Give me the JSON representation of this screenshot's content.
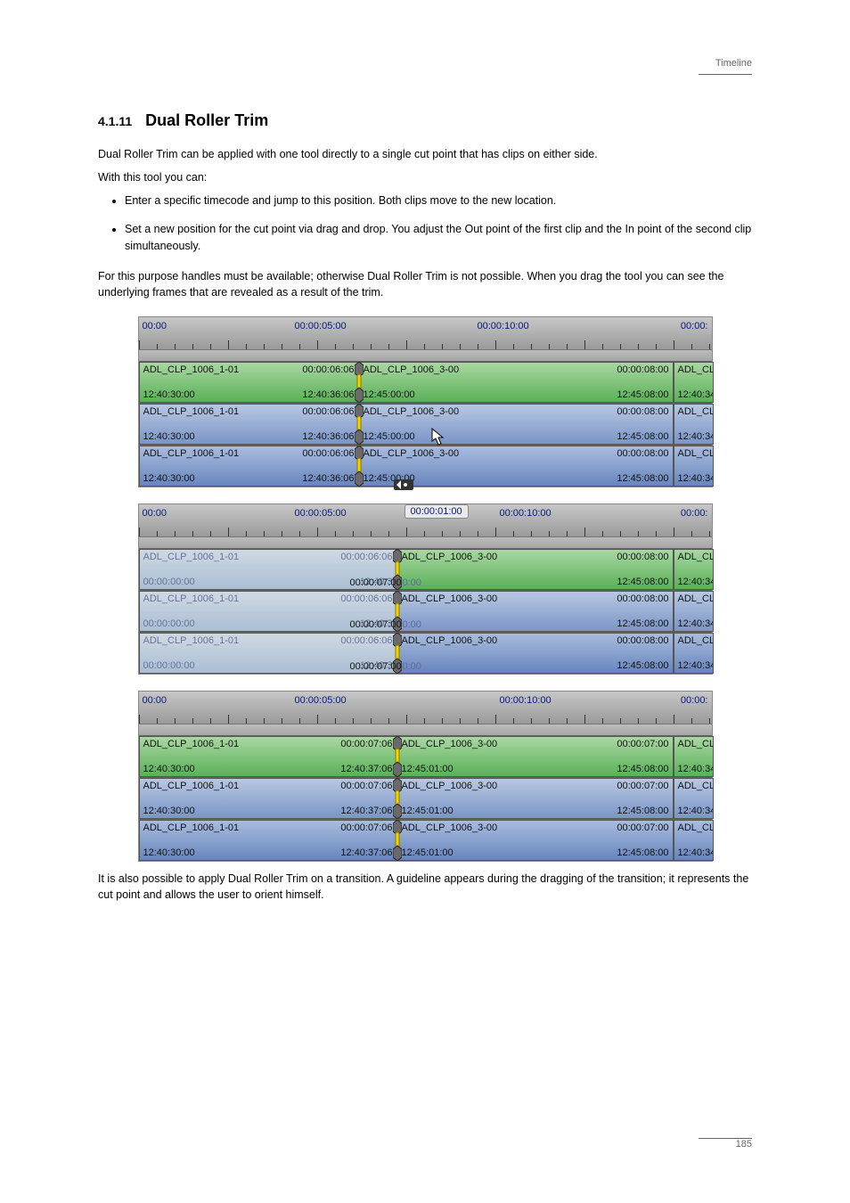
{
  "page_header": "Timeline",
  "section_number": "4.1.11",
  "section_title": "Dual Roller Trim",
  "intro_1": "Dual Roller Trim can be applied with one tool directly to a single cut point that has clips on either side.",
  "intro_2": "With this tool you can:",
  "bullets": [
    "Enter a specific timecode and jump to this position. Both clips move to the new location.",
    "Set a new position for the cut point via drag and drop. You adjust the Out point of the first clip and the In point of the second clip simultaneously."
  ],
  "para_after": "For this purpose handles must be available; otherwise Dual Roller Trim is not possible. When you drag the tool you can see the underlying frames that are revealed as a result of the trim.",
  "ruler_labels": [
    "00:00",
    "00:00:05:00",
    "00:00:10:00",
    "00:00:"
  ],
  "tooltip": "00:00:01:00",
  "panel1": {
    "rows": [
      {
        "style": "green",
        "a": {
          "name": "ADL_CLP_1006_1-01",
          "dur": "00:00:06:06",
          "in": "12:40:30:00",
          "out": "12:40:36:06"
        },
        "b": {
          "name": "ADL_CLP_1006_3-00",
          "dur": "00:00:08:00",
          "in": "12:45:00:00",
          "out": "12:45:08:00"
        },
        "c": {
          "name": "ADL_CLI",
          "in": "12:40:34:"
        }
      },
      {
        "style": "blue",
        "a": {
          "name": "ADL_CLP_1006_1-01",
          "dur": "00:00:06:06",
          "in": "12:40:30:00",
          "out": "12:40:36:06"
        },
        "b": {
          "name": "ADL_CLP_1006_3-00",
          "dur": "00:00:08:00",
          "in": "12:45:00:00",
          "out": "12:45:08:00"
        },
        "c": {
          "name": "ADL_CLI",
          "in": "12:40:34:"
        }
      },
      {
        "style": "blue2",
        "a": {
          "name": "ADL_CLP_1006_1-01",
          "dur": "00:00:06:06",
          "in": "12:40:30:00",
          "out": "12:40:36:06"
        },
        "b": {
          "name": "ADL_CLP_1006_3-00",
          "dur": "00:00:08:00",
          "in": "12:45:00:00",
          "out": "12:45:08:00"
        },
        "c": {
          "name": "ADL_CLI",
          "in": "12:40:34:"
        }
      }
    ]
  },
  "panel2": {
    "overlay_in": "00:00:00:00",
    "overlay_mid": "00:00:07:00",
    "overlay_tail": "0:00",
    "rows": [
      {
        "style": "green",
        "a": {
          "name": "ADL_CLP_1006_1-01",
          "dur": "00:00:06:06",
          "out": "12:40:3"
        },
        "b": {
          "name": "ADL_CLP_1006_3-00",
          "dur": "00:00:08:00",
          "out": "12:45:08:00"
        },
        "c": {
          "name": "ADL_CLI",
          "in": "12:40:34:"
        }
      },
      {
        "style": "blue",
        "a": {
          "name": "ADL_CLP_1006_1-01",
          "dur": "00:00:06:06",
          "out": "12:40:3"
        },
        "b": {
          "name": "ADL_CLP_1006_3-00",
          "dur": "00:00:08:00",
          "out": "12:45:08:00"
        },
        "c": {
          "name": "ADL_CLI",
          "in": "12:40:34:"
        }
      },
      {
        "style": "blue2",
        "a": {
          "name": "ADL_CLP_1006_1-01",
          "dur": "00:00:06:06",
          "out": "12:40:3"
        },
        "b": {
          "name": "ADL_CLP_1006_3-00",
          "dur": "00:00:08:00",
          "out": "12:45:08:00"
        },
        "c": {
          "name": "ADL_CLI",
          "in": "12:40:34:"
        }
      }
    ]
  },
  "panel3": {
    "rows": [
      {
        "style": "green",
        "a": {
          "name": "ADL_CLP_1006_1-01",
          "dur": "00:00:07:06",
          "in": "12:40:30:00",
          "out": "12:40:37:06"
        },
        "b": {
          "name": "ADL_CLP_1006_3-00",
          "dur": "00:00:07:00",
          "in": "12:45:01:00",
          "out": "12:45:08:00"
        },
        "c": {
          "name": "ADL_CLI",
          "in": "12:40:34:"
        }
      },
      {
        "style": "blue",
        "a": {
          "name": "ADL_CLP_1006_1-01",
          "dur": "00:00:07:06",
          "in": "12:40:30:00",
          "out": "12:40:37:06"
        },
        "b": {
          "name": "ADL_CLP_1006_3-00",
          "dur": "00:00:07:00",
          "in": "12:45:01:00",
          "out": "12:45:08:00"
        },
        "c": {
          "name": "ADL_CLI",
          "in": "12:40:34:"
        }
      },
      {
        "style": "blue2",
        "a": {
          "name": "ADL_CLP_1006_1-01",
          "dur": "00:00:07:06",
          "in": "12:40:30:00",
          "out": "12:40:37:06"
        },
        "b": {
          "name": "ADL_CLP_1006_3-00",
          "dur": "00:00:07:00",
          "in": "12:45:01:00",
          "out": "12:45:08:00"
        },
        "c": {
          "name": "ADL_CLI",
          "in": "12:40:34:"
        }
      }
    ]
  },
  "note": "It is also possible to apply Dual Roller Trim on a transition. A guideline appears during the dragging of the transition; it represents the cut point and allows the user to orient himself.",
  "page_number": "185"
}
